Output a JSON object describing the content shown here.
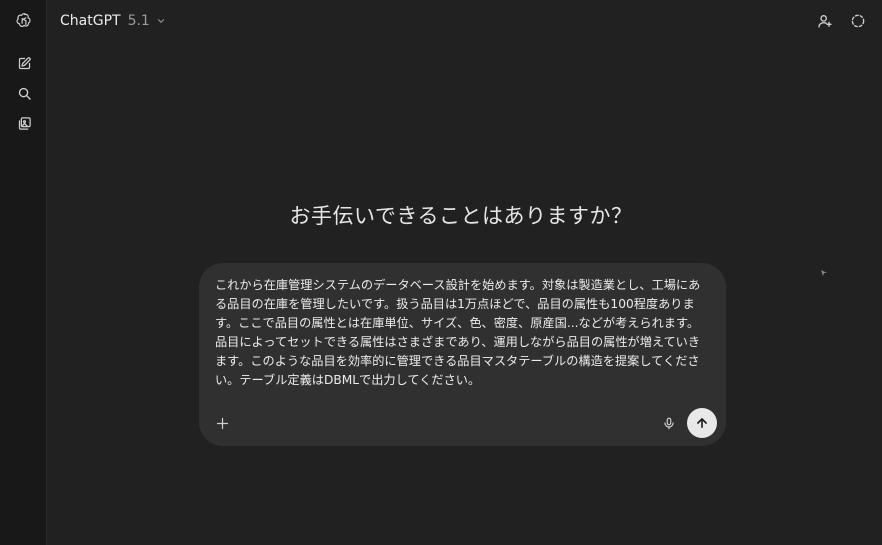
{
  "header": {
    "model_name": "ChatGPT",
    "model_version": "5.1"
  },
  "sidebar": {
    "icons": [
      "openai-logo-icon",
      "new-chat-icon",
      "search-icon",
      "library-icon"
    ]
  },
  "main": {
    "greeting": "お手伝いできることはありますか？"
  },
  "composer": {
    "text": "これから在庫管理システムのデータベース設計を始めます。対象は製造業とし、工場にある品目の在庫を管理したいです。扱う品目は1万点ほどで、品目の属性も100程度あります。ここで品目の属性とは在庫単位、サイズ、色、密度、原産国...などが考えられます。品目によってセットできる属性はさまざまであり、運用しながら品目の属性が増えていきます。このような品目を効率的に管理できる品目マスタテーブルの構造を提案してください。テーブル定義はDBMLで出力してください。"
  },
  "colors": {
    "background": "#212121",
    "sidebar": "#181818",
    "composer": "#303030",
    "send_button": "#e8e8e8"
  }
}
